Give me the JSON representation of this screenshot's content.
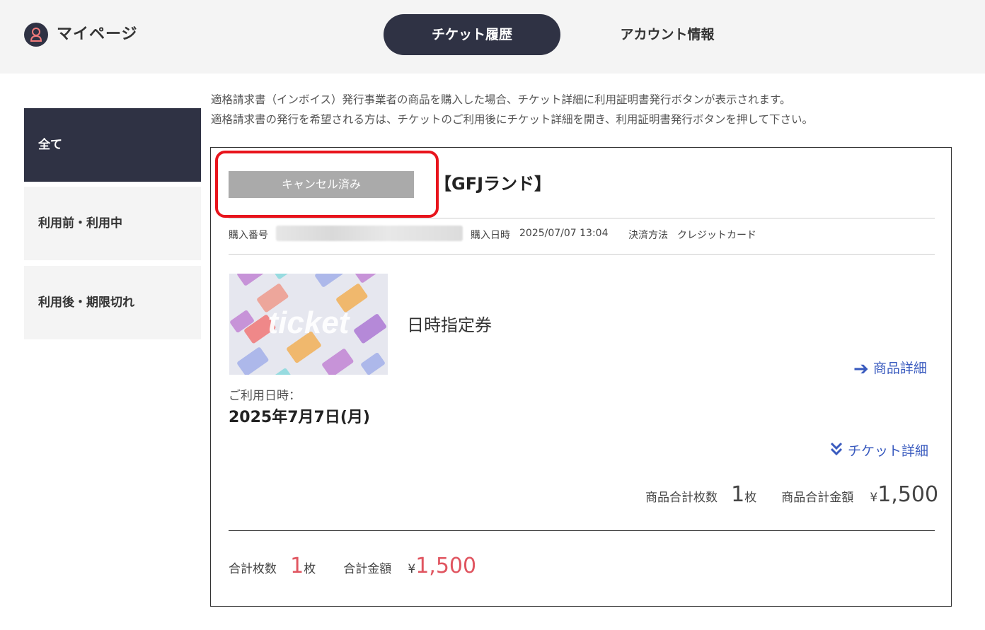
{
  "header": {
    "title": "マイページ",
    "tabs": [
      "チケット履歴",
      "アカウント情報"
    ]
  },
  "sidebar": {
    "items": [
      {
        "label": "全て"
      },
      {
        "label": "利用前・利用中"
      },
      {
        "label": "利用後・期限切れ"
      }
    ]
  },
  "notice": {
    "line1": "適格請求書（インボイス）発行事業者の商品を購入した場合、チケット詳細に利用証明書発行ボタンが表示されます。",
    "line2": "適格請求書の発行を希望される方は、チケットのご利用後にチケット詳細を開き、利用証明書発行ボタンを押して下さい。"
  },
  "order": {
    "status": "キャンセル済み",
    "facility": "【GFJランド】",
    "purchase_number_label": "購入番号",
    "purchase_date_label": "購入日時",
    "purchase_date": "2025/07/07 13:04",
    "payment_label": "決済方法",
    "payment_method": "クレジットカード",
    "image_text": "ticket",
    "product_name": "日時指定券",
    "product_detail_link": "商品詳細",
    "use_date_label": "ご利用日時：",
    "use_date": "2025年7月7日(月)",
    "ticket_detail_link": "チケット詳細",
    "item_count_label": "商品合計枚数",
    "item_count": "1",
    "item_count_unit": "枚",
    "item_amount_label": "商品合計金額",
    "currency": "¥",
    "item_amount": "1,500",
    "total_count_label": "合計枚数",
    "total_count": "1",
    "total_count_unit": "枚",
    "total_amount_label": "合計金額",
    "total_amount": "1,500"
  },
  "colors": {
    "navy": "#2f3244",
    "highlight_red": "#e8141c",
    "link_blue": "#3a5bbf",
    "total_red": "#e05560",
    "badge_gray": "#aaaaaa"
  }
}
